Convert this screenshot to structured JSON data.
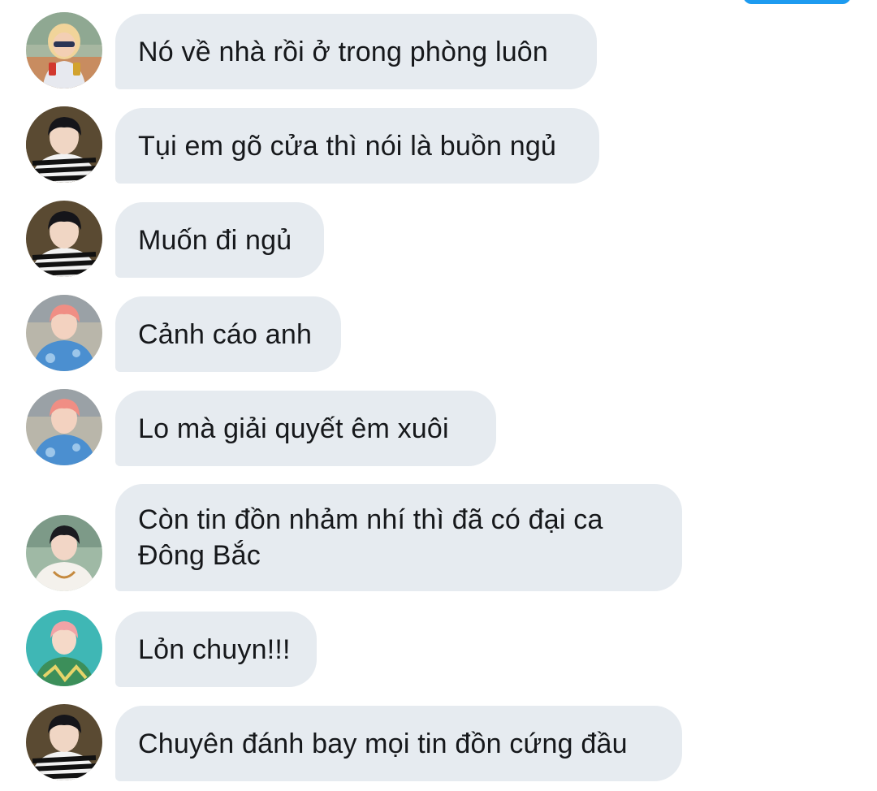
{
  "colors": {
    "bubble_background": "#e6ebf0",
    "text": "#16181b",
    "accent": "#1d9bf0"
  },
  "messages": [
    {
      "text": "Nó về nhà rồi ở trong phòng luôn",
      "avatar": "avatar-blond-sunglasses"
    },
    {
      "text": "Tụi em gõ cửa thì nói là buồn ngủ",
      "avatar": "avatar-striped-shirt"
    },
    {
      "text": "Muốn đi ngủ",
      "avatar": "avatar-striped-shirt"
    },
    {
      "text": "Cảnh cáo anh",
      "avatar": "avatar-pink-hair-blue-tie-dye"
    },
    {
      "text": "Lo mà giải quyết êm xuôi",
      "avatar": "avatar-pink-hair-blue-tie-dye"
    },
    {
      "text": "Còn tin đồn nhảm nhí thì đã có đại ca\nĐông Bắc",
      "avatar": "avatar-dark-hair-white-shirt"
    },
    {
      "text": "Lỏn chuyn!!!",
      "avatar": "avatar-pink-hair-teal-background"
    },
    {
      "text": "Chuyên đánh bay mọi tin đồn cứng đầu",
      "avatar": "avatar-striped-shirt"
    }
  ]
}
